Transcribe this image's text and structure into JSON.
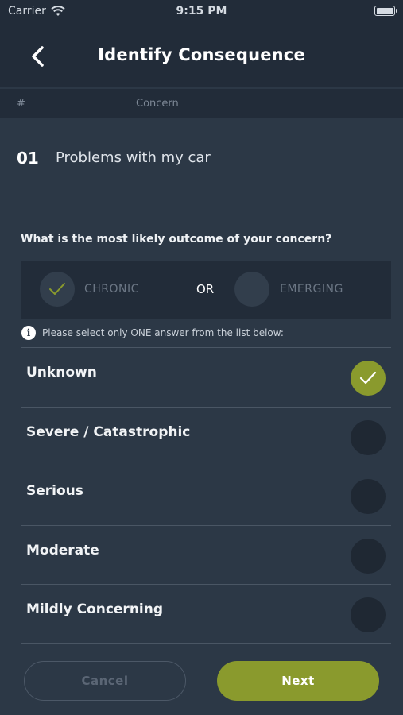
{
  "status_bar": {
    "carrier": "Carrier",
    "time": "9:15 PM",
    "battery_level": 1.0
  },
  "header": {
    "title": "Identify Consequence",
    "back_icon": "chevron-left-icon"
  },
  "columns": {
    "number": "#",
    "concern": "Concern"
  },
  "concern": {
    "number": "01",
    "text": "Problems with my car"
  },
  "question": "What is the most likely outcome of your concern?",
  "toggle": {
    "option_a": "CHRONIC",
    "separator": "OR",
    "option_b": "EMERGING",
    "selected": "CHRONIC"
  },
  "info": {
    "icon": "info-icon",
    "glyph": "i",
    "text": "Please select only ONE answer from the list below:"
  },
  "options": [
    {
      "label": "Unknown",
      "selected": true
    },
    {
      "label": "Severe / Catastrophic",
      "selected": false
    },
    {
      "label": "Serious",
      "selected": false
    },
    {
      "label": "Moderate",
      "selected": false
    },
    {
      "label": "Mildly Concerning",
      "selected": false
    }
  ],
  "buttons": {
    "cancel": "Cancel",
    "next": "Next"
  },
  "colors": {
    "accent": "#8a9a2d",
    "background": "#2c3846",
    "header": "#222c39"
  }
}
